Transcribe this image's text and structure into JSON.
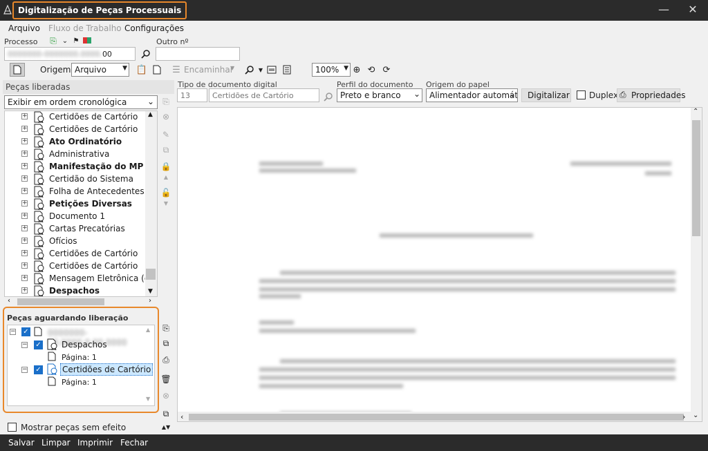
{
  "window": {
    "title": "Digitalização de Peças Processuais",
    "minimize": "—",
    "close": "✕"
  },
  "menu": {
    "arquivo": "Arquivo",
    "fluxo": "Fluxo de Trabalho",
    "configuracoes": "Configurações"
  },
  "form": {
    "processo_label": "Processo",
    "outro_label": "Outro nº",
    "processo_value_visible": "00",
    "origem_label": "Origem",
    "origem_value": "Arquivo",
    "encaminhar": "Encaminhar",
    "zoom": "100%"
  },
  "left": {
    "header": "Peças liberadas",
    "sort": "Exibir em ordem cronológica",
    "items": [
      {
        "label": "Certidões de Cartório",
        "bold": false
      },
      {
        "label": "Certidões de Cartório",
        "bold": false
      },
      {
        "label": "Ato Ordinatório",
        "bold": true
      },
      {
        "label": "Administrativa",
        "bold": false
      },
      {
        "label": "Manifestação do MP",
        "bold": true
      },
      {
        "label": "Certidão do Sistema",
        "bold": false
      },
      {
        "label": "Folha de Antecedentes",
        "bold": false
      },
      {
        "label": "Petições Diversas",
        "bold": true
      },
      {
        "label": "Documento 1",
        "bold": false
      },
      {
        "label": "Cartas Precatórias",
        "bold": false
      },
      {
        "label": "Ofícios",
        "bold": false
      },
      {
        "label": "Certidões de Cartório",
        "bold": false
      },
      {
        "label": "Certidões de Cartório",
        "bold": false
      },
      {
        "label": "Mensagem Eletrônica (e-ma",
        "bold": false
      },
      {
        "label": "Despachos",
        "bold": true
      }
    ],
    "await_title": "Peças aguardando liberação",
    "await_items": {
      "despachos": "Despachos",
      "pagina1": "Página: 1",
      "certidoes": "Certidões de Cartório",
      "pagina2": "Página: 1"
    },
    "show_no_effect": "Mostrar peças sem efeito"
  },
  "right": {
    "tipo_label": "Tipo de documento digital",
    "tipo_code": "13",
    "tipo_value": "Certidões de Cartório",
    "perfil_label": "Perfil do documento",
    "perfil_value": "Preto e branco",
    "origem_papel_label": "Origem do papel",
    "origem_papel_value": "Alimentador automát",
    "digitalizar": "Digitalizar",
    "duplex": "Duplex",
    "propriedades": "Propriedades"
  },
  "bottom": {
    "salvar": "Salvar",
    "limpar": "Limpar",
    "imprimir": "Imprimir",
    "fechar": "Fechar"
  },
  "colors": {
    "accent": "#e8882b",
    "titlebar": "#2b2b2b",
    "selection": "#cce8ff",
    "check": "#1a6fc9"
  }
}
